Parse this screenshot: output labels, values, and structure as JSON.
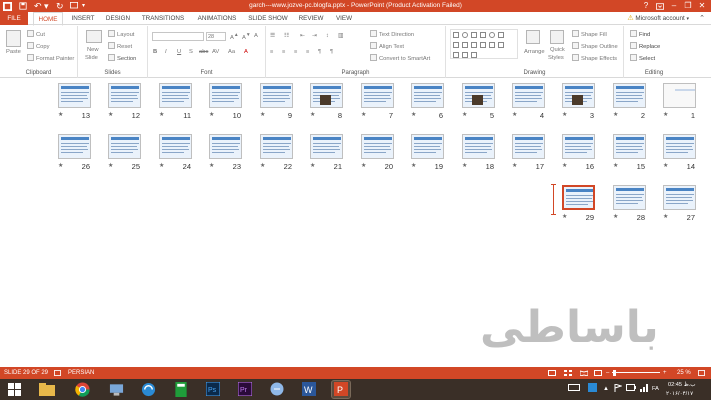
{
  "window": {
    "title": "garch---www.jozve-pc.blogfa.pptx - PowerPoint (Product Activation Failed)",
    "help": "?",
    "minimize": "–",
    "restore": "❐",
    "close": "✕"
  },
  "tabs": [
    "FILE",
    "HOME",
    "INSERT",
    "DESIGN",
    "TRANSITIONS",
    "ANIMATIONS",
    "SLIDE SHOW",
    "REVIEW",
    "VIEW"
  ],
  "account": {
    "label": "Microsoft account",
    "warning": "⚠"
  },
  "ribbon": {
    "clipboard": {
      "label": "Clipboard",
      "paste": "Paste",
      "cut": "Cut",
      "copy": "Copy",
      "format_painter": "Format Painter"
    },
    "slides": {
      "label": "Slides",
      "new_slide": "New",
      "new_slide2": "Slide",
      "layout": "Layout",
      "reset": "Reset",
      "section": "Section"
    },
    "font": {
      "label": "Font",
      "size": "28",
      "bold": "B",
      "italic": "I",
      "underline": "U",
      "strike": "S",
      "shadow": "abc",
      "spacing": "AV",
      "case": "Aa"
    },
    "paragraph": {
      "label": "Paragraph",
      "text_direction": "Text Direction",
      "align_text": "Align Text",
      "convert_smartart": "Convert to SmartArt"
    },
    "drawing": {
      "label": "Drawing",
      "arrange": "Arrange",
      "quick_styles": "Quick",
      "quick_styles2": "Styles",
      "shape_fill": "Shape Fill",
      "shape_outline": "Shape Outline",
      "shape_effects": "Shape Effects"
    },
    "editing": {
      "label": "Editing",
      "find": "Find",
      "replace": "Replace",
      "select": "Select"
    }
  },
  "slides": {
    "row1": [
      "13",
      "12",
      "11",
      "10",
      "9",
      "8",
      "7",
      "6",
      "5",
      "4",
      "3",
      "2",
      "1"
    ],
    "row2": [
      "26",
      "25",
      "24",
      "23",
      "22",
      "21",
      "20",
      "19",
      "18",
      "17",
      "16",
      "15",
      "14"
    ],
    "row3": [
      "29",
      "28",
      "27"
    ],
    "star": "★"
  },
  "watermark": "باساطی",
  "status": {
    "slide": "SLIDE 29 OF 29",
    "language": "PERSIAN",
    "zoom": "25 %",
    "zoom_minus": "–",
    "zoom_plus": "+"
  },
  "taskbar": {
    "lang": "FA",
    "time": "02:45 ب.ظ",
    "date": "۲۰۱۶/۰۴/۱۷"
  },
  "colors": {
    "accent": "#d24726",
    "taskbar": "#3a2f27"
  }
}
